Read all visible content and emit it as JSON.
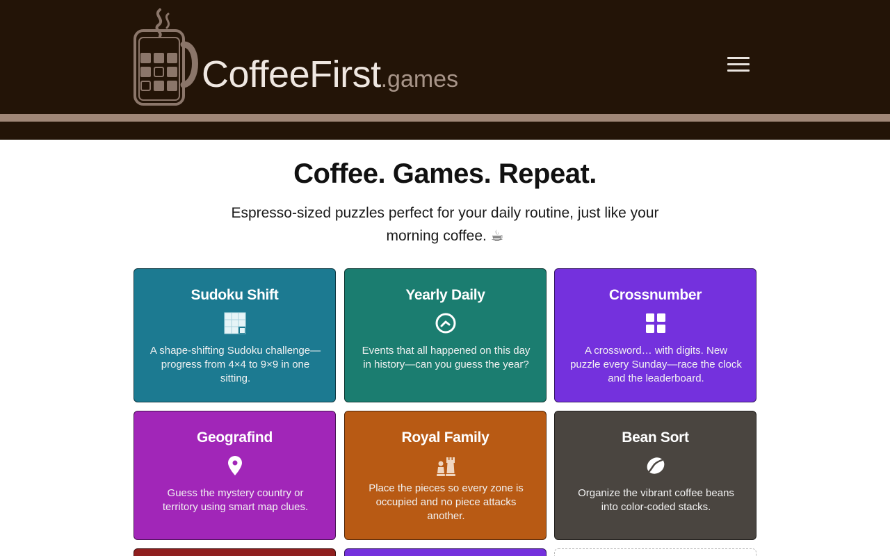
{
  "header": {
    "brand": "CoffeeFirst",
    "brand_tld": ".games",
    "menu_icon": "hamburger-menu-icon"
  },
  "hero": {
    "title": "Coffee. Games. Repeat.",
    "subtitle": "Espresso-sized puzzles perfect for your daily routine, just like your morning coffee. ☕"
  },
  "games": [
    {
      "title": "Sudoku Shift",
      "icon": "sudoku-grid-icon",
      "description": "A shape-shifting Sudoku challenge—progress from 4×4 to 9×9 in one sitting.",
      "color": "#1c7a91"
    },
    {
      "title": "Yearly Daily",
      "icon": "clock-icon",
      "description": "Events that all happened on this day in history—can you guess the year?",
      "color": "#1b7d70"
    },
    {
      "title": "Crossnumber",
      "icon": "grid-squares-icon",
      "description": "A crossword… with digits. New puzzle every Sunday—race the clock and the leaderboard.",
      "color": "#7431dd"
    },
    {
      "title": "Geografind",
      "icon": "map-pin-icon",
      "description": "Guess the mystery country or territory using smart map clues.",
      "color": "#a126b8"
    },
    {
      "title": "Royal Family",
      "icon": "chess-pieces-icon",
      "description": "Place the pieces so every zone is occupied and no piece attacks another.",
      "color": "#b85a14"
    },
    {
      "title": "Bean Sort",
      "icon": "coffee-bean-icon",
      "description": "Organize the vibrant coffee beans into color-coded stacks.",
      "color": "#4a4540"
    }
  ],
  "colors": {
    "header_bg": "#231407",
    "header_stripe": "#a08777",
    "logo_text": "#efe7e1",
    "logo_tld": "#a89589",
    "partial_card_1": "#8f1f1f",
    "partial_card_2": "#7431dd"
  }
}
